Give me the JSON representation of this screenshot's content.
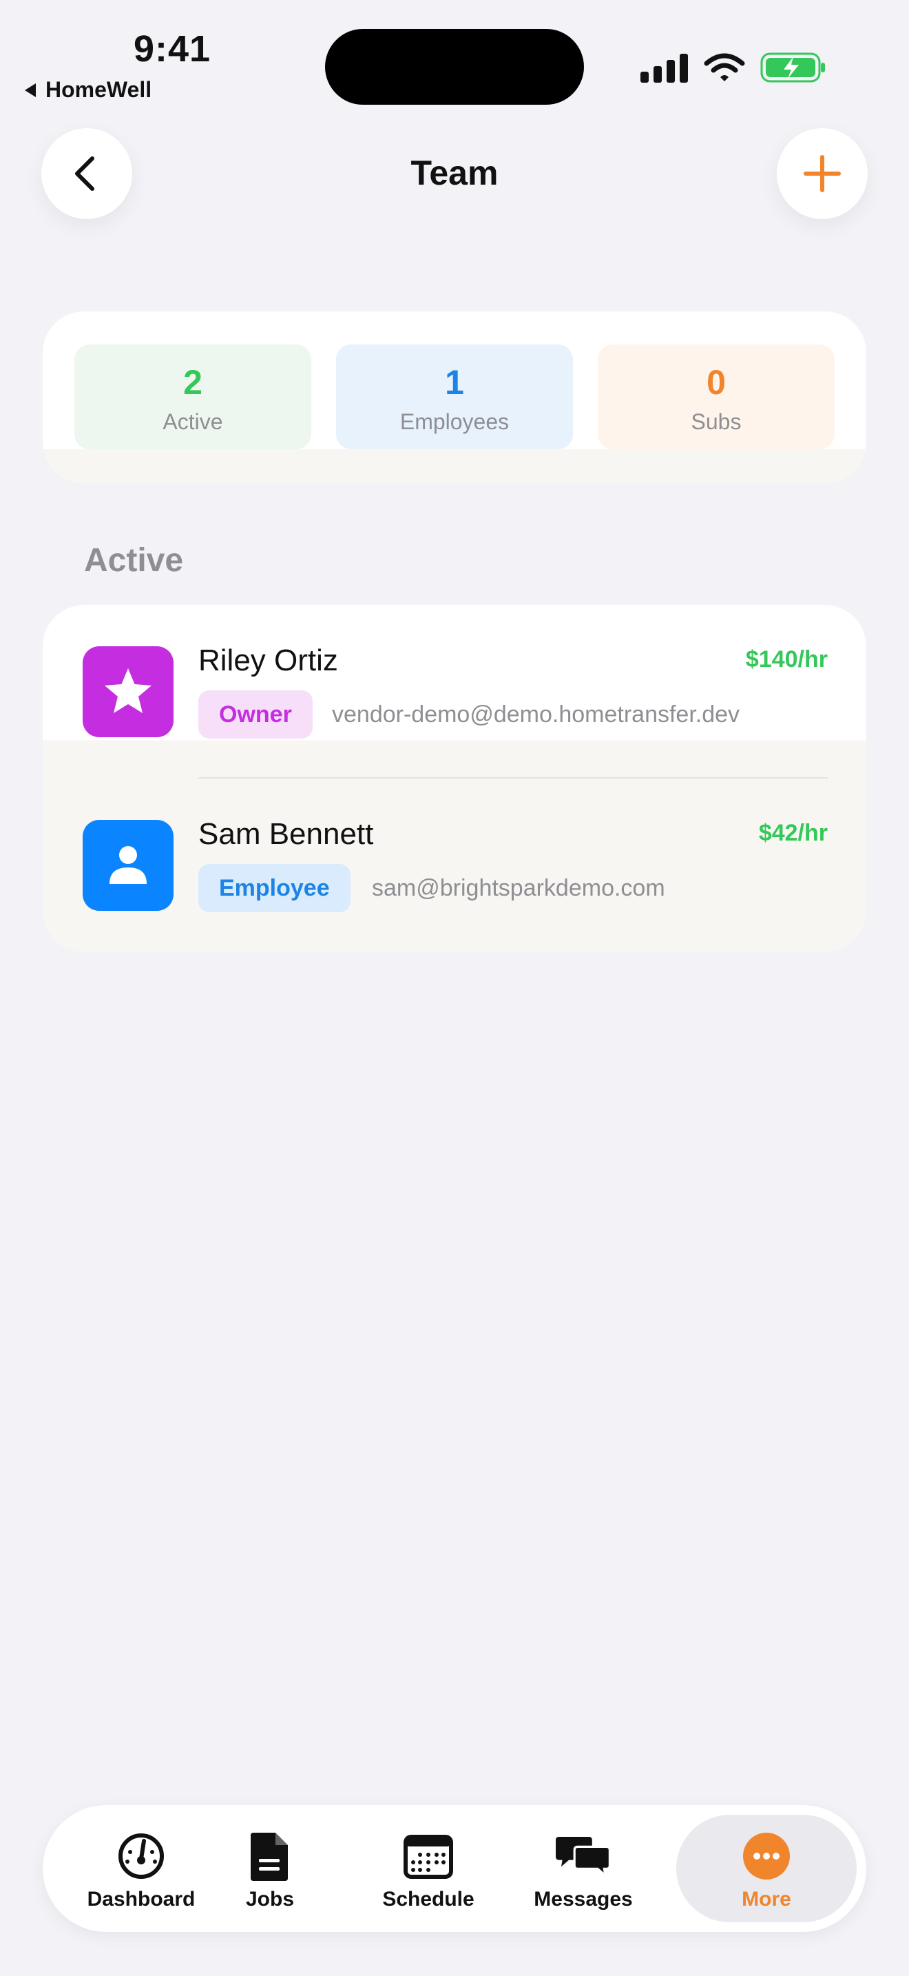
{
  "status_bar": {
    "time": "9:41",
    "back_app": "HomeWell"
  },
  "header": {
    "title": "Team",
    "back_icon": "chevron-left-icon",
    "add_icon": "plus-icon"
  },
  "stats": [
    {
      "value": "2",
      "label": "Active"
    },
    {
      "value": "1",
      "label": "Employees"
    },
    {
      "value": "0",
      "label": "Subs"
    }
  ],
  "section": {
    "label": "Active"
  },
  "members": [
    {
      "name": "Riley Ortiz",
      "rate": "$140/hr",
      "role": "Owner",
      "email": "vendor-demo@demo.hometransfer.dev",
      "icon": "star-icon"
    },
    {
      "name": "Sam Bennett",
      "rate": "$42/hr",
      "role": "Employee",
      "email": "sam@brightsparkdemo.com",
      "icon": "person-icon"
    }
  ],
  "tabs": [
    {
      "label": "Dashboard",
      "icon": "gauge-icon"
    },
    {
      "label": "Jobs",
      "icon": "document-icon"
    },
    {
      "label": "Schedule",
      "icon": "calendar-icon"
    },
    {
      "label": "Messages",
      "icon": "chat-bubbles-icon"
    },
    {
      "label": "More",
      "icon": "more-dots-icon",
      "active": true
    }
  ],
  "colors": {
    "accent": "#f0852b",
    "green": "#34c759",
    "blue": "#1b84e5",
    "owner_purple": "#c42ee0",
    "background": "#f2f2f7"
  }
}
